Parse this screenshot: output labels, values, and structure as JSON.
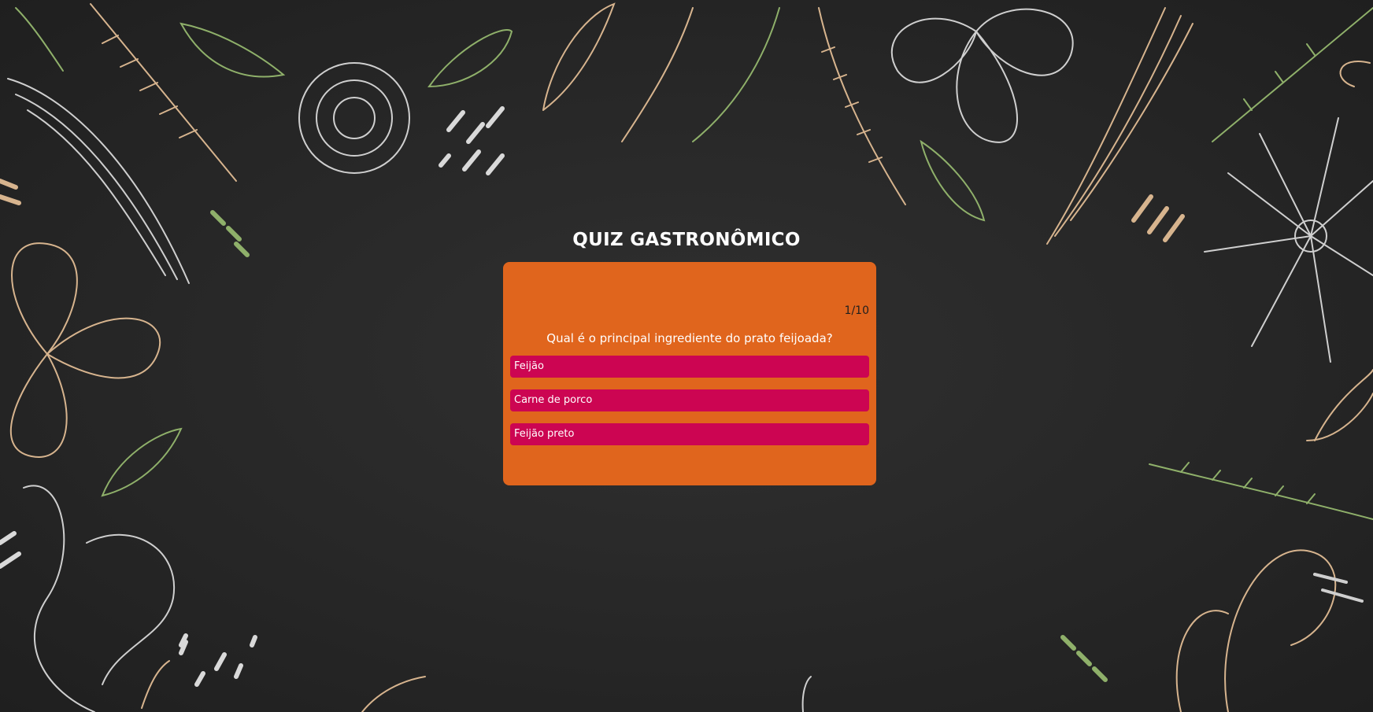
{
  "quiz": {
    "title": "QUIZ GASTRONÔMICO",
    "counter": "1/10",
    "question": "Qual é o principal ingrediente do prato feijoada?",
    "answers": [
      {
        "label": "Feijão"
      },
      {
        "label": "Carne de porco"
      },
      {
        "label": "Feijão preto"
      }
    ]
  },
  "colors": {
    "card": "#e0651d",
    "answer": "#cc0552",
    "background": "#2a2a2a"
  }
}
